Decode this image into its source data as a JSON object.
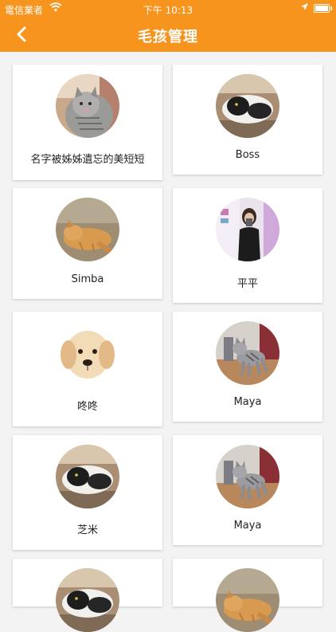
{
  "status_bar": {
    "carrier": "電信業者",
    "time": "下午 10:13"
  },
  "nav": {
    "title": "毛孩管理"
  },
  "pets": [
    {
      "name": "名字被姊姊遺忘的美短短",
      "photo": "tabby-cat"
    },
    {
      "name": "Boss",
      "photo": "black-white-cat"
    },
    {
      "name": "Simba",
      "photo": "orange-cat"
    },
    {
      "name": "平平",
      "photo": "person"
    },
    {
      "name": "咚咚",
      "photo": "yellow-puppy"
    },
    {
      "name": "Maya",
      "photo": "tabby-cat-standing"
    },
    {
      "name": "芝米",
      "photo": "black-white-cat"
    },
    {
      "name": "Maya",
      "photo": "tabby-cat-standing"
    },
    {
      "name": "",
      "photo": "black-white-cat"
    },
    {
      "name": "",
      "photo": "orange-cat"
    }
  ],
  "colors": {
    "accent": "#f7941d",
    "background": "#f3f3f3"
  }
}
